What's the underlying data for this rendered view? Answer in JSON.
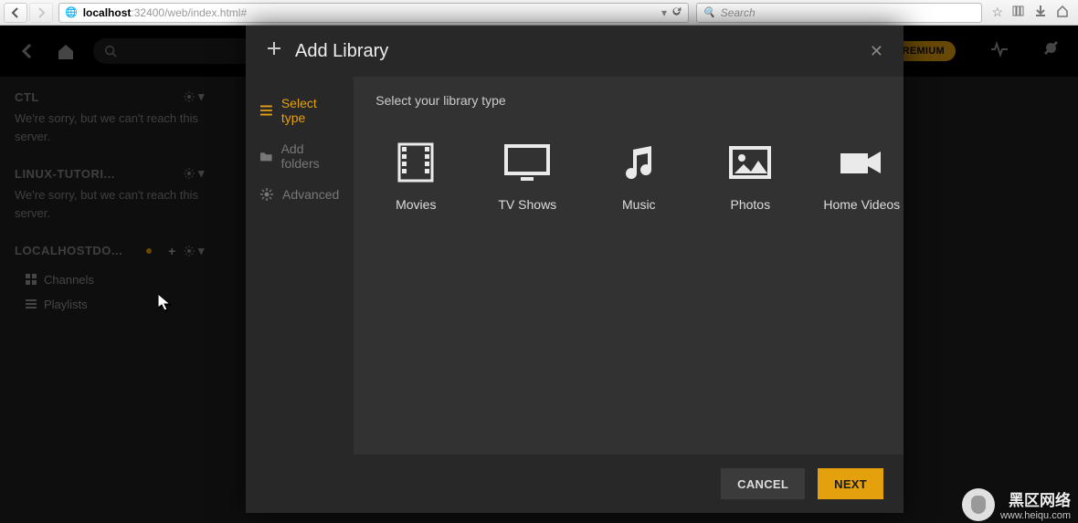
{
  "browser": {
    "url_host": "localhost",
    "url_rest": ":32400/web/index.html#",
    "search_placeholder": "Search"
  },
  "header": {
    "premium_label": "PREMIUM"
  },
  "sidebar": {
    "servers": [
      {
        "name": "CTL",
        "error": "We're sorry, but we can't reach this server."
      },
      {
        "name": "LINUX-TUTORI...",
        "error": "We're sorry, but we can't reach this server."
      },
      {
        "name": "LOCALHOSTDO...",
        "error": ""
      }
    ],
    "items": [
      {
        "label": "Channels"
      },
      {
        "label": "Playlists"
      }
    ]
  },
  "modal": {
    "title": "Add Library",
    "steps": [
      {
        "label": "Select type",
        "active": true
      },
      {
        "label": "Add folders",
        "active": false
      },
      {
        "label": "Advanced",
        "active": false
      }
    ],
    "prompt": "Select your library type",
    "types": [
      {
        "label": "Movies",
        "icon": "film"
      },
      {
        "label": "TV Shows",
        "icon": "tv"
      },
      {
        "label": "Music",
        "icon": "music"
      },
      {
        "label": "Photos",
        "icon": "photo"
      },
      {
        "label": "Home Videos",
        "icon": "camera"
      }
    ],
    "cancel_label": "CANCEL",
    "next_label": "NEXT"
  },
  "watermark": {
    "line1": "黑区网络",
    "line2": "www.heiqu.com"
  }
}
